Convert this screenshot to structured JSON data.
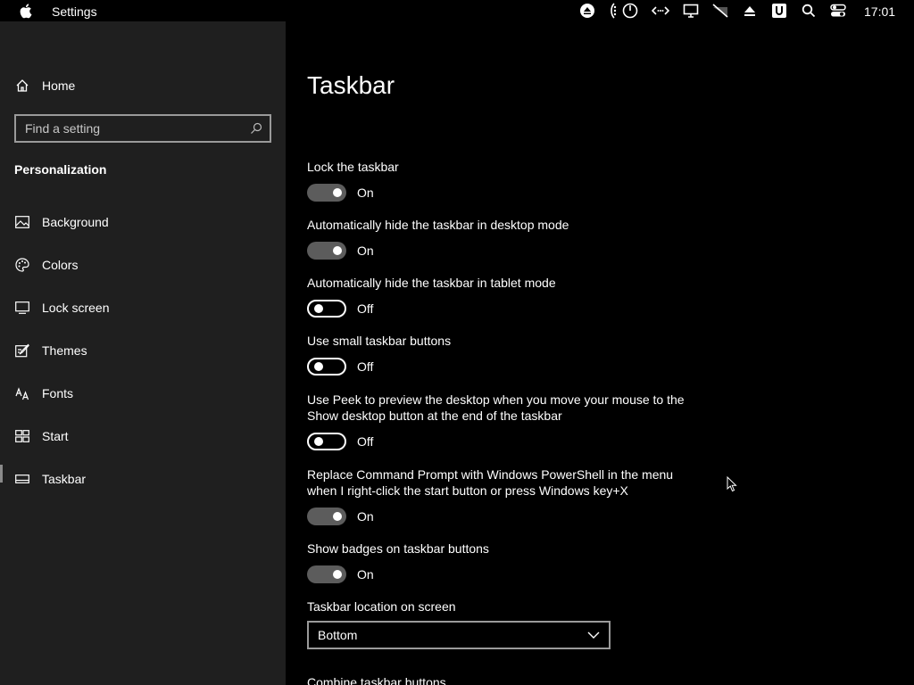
{
  "menubar": {
    "app_title": "Settings",
    "clock": "17:01",
    "tray_icons": [
      "eject-icon",
      "brightness-icon",
      "timer-icon",
      "network-arrows-icon",
      "display-icon",
      "wifi-off-icon",
      "upload-icon",
      "u-badge-icon",
      "search-icon",
      "control-center-icon"
    ]
  },
  "sidebar": {
    "home_label": "Home",
    "search_placeholder": "Find a setting",
    "section": "Personalization",
    "items": [
      {
        "label": "Background",
        "icon": "picture-icon"
      },
      {
        "label": "Colors",
        "icon": "palette-icon"
      },
      {
        "label": "Lock screen",
        "icon": "lock-screen-icon"
      },
      {
        "label": "Themes",
        "icon": "brush-icon"
      },
      {
        "label": "Fonts",
        "icon": "fonts-icon"
      },
      {
        "label": "Start",
        "icon": "start-icon"
      },
      {
        "label": "Taskbar",
        "icon": "taskbar-icon"
      }
    ],
    "active_item": "Taskbar"
  },
  "main": {
    "title": "Taskbar",
    "settings": [
      {
        "label": "Lock the taskbar",
        "state": "On"
      },
      {
        "label": "Automatically hide the taskbar in desktop mode",
        "state": "On"
      },
      {
        "label": "Automatically hide the taskbar in tablet mode",
        "state": "Off"
      },
      {
        "label": "Use small taskbar buttons",
        "state": "Off"
      },
      {
        "label": "Use Peek to preview the desktop when you move your mouse to the Show desktop button at the end of the taskbar",
        "state": "Off"
      },
      {
        "label": "Replace Command Prompt with Windows PowerShell in the menu when I right-click the start button or press Windows key+X",
        "state": "On"
      },
      {
        "label": "Show badges on taskbar buttons",
        "state": "On"
      }
    ],
    "location_label": "Taskbar location on screen",
    "location_value": "Bottom",
    "next_section_label": "Combine taskbar buttons"
  },
  "colors": {
    "sidebar_bg": "#1f1f1f",
    "main_bg": "#000000",
    "toggle_on": "#5c5c5c"
  }
}
